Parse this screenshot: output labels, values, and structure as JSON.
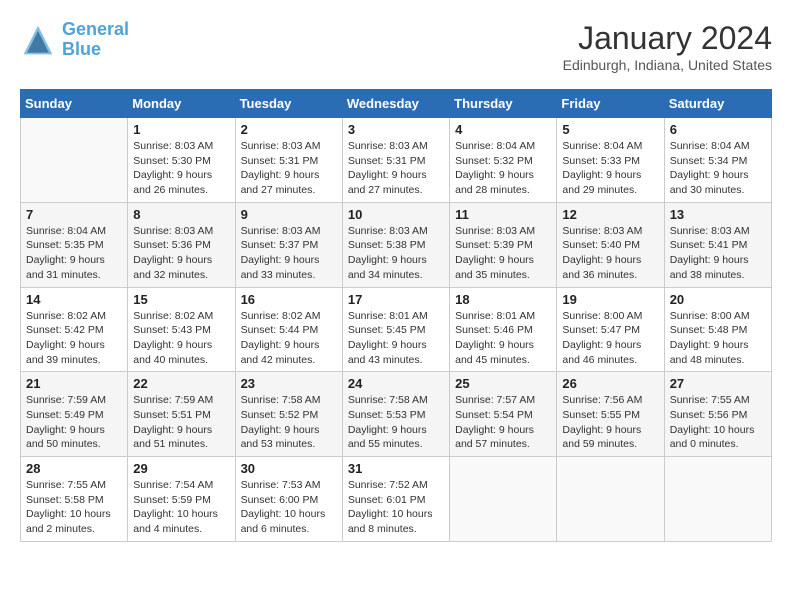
{
  "logo": {
    "text_general": "General",
    "text_blue": "Blue"
  },
  "title": "January 2024",
  "subtitle": "Edinburgh, Indiana, United States",
  "weekdays": [
    "Sunday",
    "Monday",
    "Tuesday",
    "Wednesday",
    "Thursday",
    "Friday",
    "Saturday"
  ],
  "weeks": [
    [
      {
        "day": "",
        "empty": true
      },
      {
        "day": "1",
        "sunrise": "8:03 AM",
        "sunset": "5:30 PM",
        "daylight": "9 hours and 26 minutes."
      },
      {
        "day": "2",
        "sunrise": "8:03 AM",
        "sunset": "5:31 PM",
        "daylight": "9 hours and 27 minutes."
      },
      {
        "day": "3",
        "sunrise": "8:03 AM",
        "sunset": "5:31 PM",
        "daylight": "9 hours and 27 minutes."
      },
      {
        "day": "4",
        "sunrise": "8:04 AM",
        "sunset": "5:32 PM",
        "daylight": "9 hours and 28 minutes."
      },
      {
        "day": "5",
        "sunrise": "8:04 AM",
        "sunset": "5:33 PM",
        "daylight": "9 hours and 29 minutes."
      },
      {
        "day": "6",
        "sunrise": "8:04 AM",
        "sunset": "5:34 PM",
        "daylight": "9 hours and 30 minutes."
      }
    ],
    [
      {
        "day": "7",
        "sunrise": "8:04 AM",
        "sunset": "5:35 PM",
        "daylight": "9 hours and 31 minutes."
      },
      {
        "day": "8",
        "sunrise": "8:03 AM",
        "sunset": "5:36 PM",
        "daylight": "9 hours and 32 minutes."
      },
      {
        "day": "9",
        "sunrise": "8:03 AM",
        "sunset": "5:37 PM",
        "daylight": "9 hours and 33 minutes."
      },
      {
        "day": "10",
        "sunrise": "8:03 AM",
        "sunset": "5:38 PM",
        "daylight": "9 hours and 34 minutes."
      },
      {
        "day": "11",
        "sunrise": "8:03 AM",
        "sunset": "5:39 PM",
        "daylight": "9 hours and 35 minutes."
      },
      {
        "day": "12",
        "sunrise": "8:03 AM",
        "sunset": "5:40 PM",
        "daylight": "9 hours and 36 minutes."
      },
      {
        "day": "13",
        "sunrise": "8:03 AM",
        "sunset": "5:41 PM",
        "daylight": "9 hours and 38 minutes."
      }
    ],
    [
      {
        "day": "14",
        "sunrise": "8:02 AM",
        "sunset": "5:42 PM",
        "daylight": "9 hours and 39 minutes."
      },
      {
        "day": "15",
        "sunrise": "8:02 AM",
        "sunset": "5:43 PM",
        "daylight": "9 hours and 40 minutes."
      },
      {
        "day": "16",
        "sunrise": "8:02 AM",
        "sunset": "5:44 PM",
        "daylight": "9 hours and 42 minutes."
      },
      {
        "day": "17",
        "sunrise": "8:01 AM",
        "sunset": "5:45 PM",
        "daylight": "9 hours and 43 minutes."
      },
      {
        "day": "18",
        "sunrise": "8:01 AM",
        "sunset": "5:46 PM",
        "daylight": "9 hours and 45 minutes."
      },
      {
        "day": "19",
        "sunrise": "8:00 AM",
        "sunset": "5:47 PM",
        "daylight": "9 hours and 46 minutes."
      },
      {
        "day": "20",
        "sunrise": "8:00 AM",
        "sunset": "5:48 PM",
        "daylight": "9 hours and 48 minutes."
      }
    ],
    [
      {
        "day": "21",
        "sunrise": "7:59 AM",
        "sunset": "5:49 PM",
        "daylight": "9 hours and 50 minutes."
      },
      {
        "day": "22",
        "sunrise": "7:59 AM",
        "sunset": "5:51 PM",
        "daylight": "9 hours and 51 minutes."
      },
      {
        "day": "23",
        "sunrise": "7:58 AM",
        "sunset": "5:52 PM",
        "daylight": "9 hours and 53 minutes."
      },
      {
        "day": "24",
        "sunrise": "7:58 AM",
        "sunset": "5:53 PM",
        "daylight": "9 hours and 55 minutes."
      },
      {
        "day": "25",
        "sunrise": "7:57 AM",
        "sunset": "5:54 PM",
        "daylight": "9 hours and 57 minutes."
      },
      {
        "day": "26",
        "sunrise": "7:56 AM",
        "sunset": "5:55 PM",
        "daylight": "9 hours and 59 minutes."
      },
      {
        "day": "27",
        "sunrise": "7:55 AM",
        "sunset": "5:56 PM",
        "daylight": "10 hours and 0 minutes."
      }
    ],
    [
      {
        "day": "28",
        "sunrise": "7:55 AM",
        "sunset": "5:58 PM",
        "daylight": "10 hours and 2 minutes."
      },
      {
        "day": "29",
        "sunrise": "7:54 AM",
        "sunset": "5:59 PM",
        "daylight": "10 hours and 4 minutes."
      },
      {
        "day": "30",
        "sunrise": "7:53 AM",
        "sunset": "6:00 PM",
        "daylight": "10 hours and 6 minutes."
      },
      {
        "day": "31",
        "sunrise": "7:52 AM",
        "sunset": "6:01 PM",
        "daylight": "10 hours and 8 minutes."
      },
      {
        "day": "",
        "empty": true
      },
      {
        "day": "",
        "empty": true
      },
      {
        "day": "",
        "empty": true
      }
    ]
  ]
}
